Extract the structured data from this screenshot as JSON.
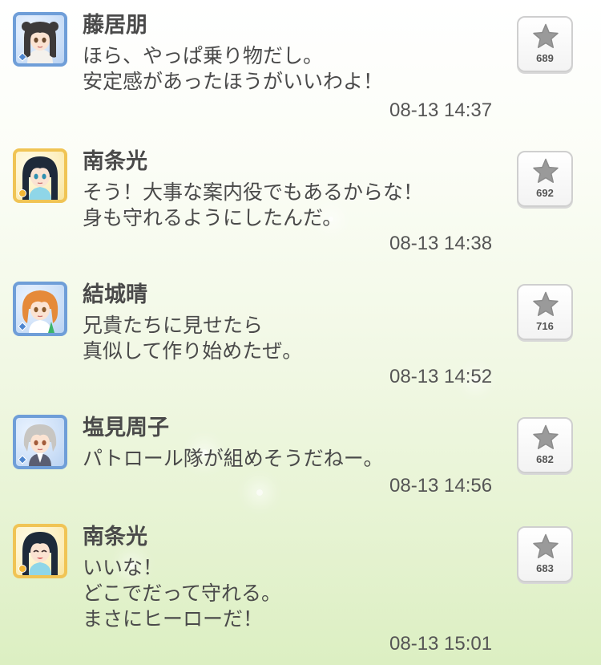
{
  "posts": [
    {
      "name": "藤居朋",
      "lines": [
        "ほら、やっぱ乗り物だし。",
        "安定感があったほうがいいわよ！"
      ],
      "time": "08-13 14:37",
      "likes": "689",
      "avatar_type": "cool",
      "avatar_icon": "character-avatar-dark-hair-bun",
      "like_icon": "star-icon"
    },
    {
      "name": "南条光",
      "lines": [
        "そう！大事な案内役でもあるからな！",
        "身も守れるようにしたんだ。"
      ],
      "time": "08-13 14:38",
      "likes": "692",
      "avatar_type": "passion",
      "avatar_icon": "character-avatar-long-black-hair",
      "like_icon": "star-icon"
    },
    {
      "name": "結城晴",
      "lines": [
        "兄貴たちに見せたら",
        "真似して作り始めたぜ。"
      ],
      "time": "08-13 14:52",
      "likes": "716",
      "avatar_type": "cool",
      "avatar_icon": "character-avatar-orange-hair",
      "like_icon": "star-icon"
    },
    {
      "name": "塩見周子",
      "lines": [
        "パトロール隊が組めそうだねー。"
      ],
      "time": "08-13 14:56",
      "likes": "682",
      "avatar_type": "cool",
      "avatar_icon": "character-avatar-silver-hair",
      "like_icon": "star-icon"
    },
    {
      "name": "南条光",
      "lines": [
        "いいな！",
        "どこでだって守れる。",
        "まさにヒーローだ！"
      ],
      "time": "08-13 15:01",
      "likes": "683",
      "avatar_type": "passion",
      "avatar_icon": "character-avatar-long-black-hair-smiling",
      "like_icon": "star-icon"
    }
  ],
  "colors": {
    "cool_frame": "#6f9ed8",
    "passion_frame": "#f0c455",
    "text": "#4a4a4a",
    "star": "#9a9a9a"
  }
}
